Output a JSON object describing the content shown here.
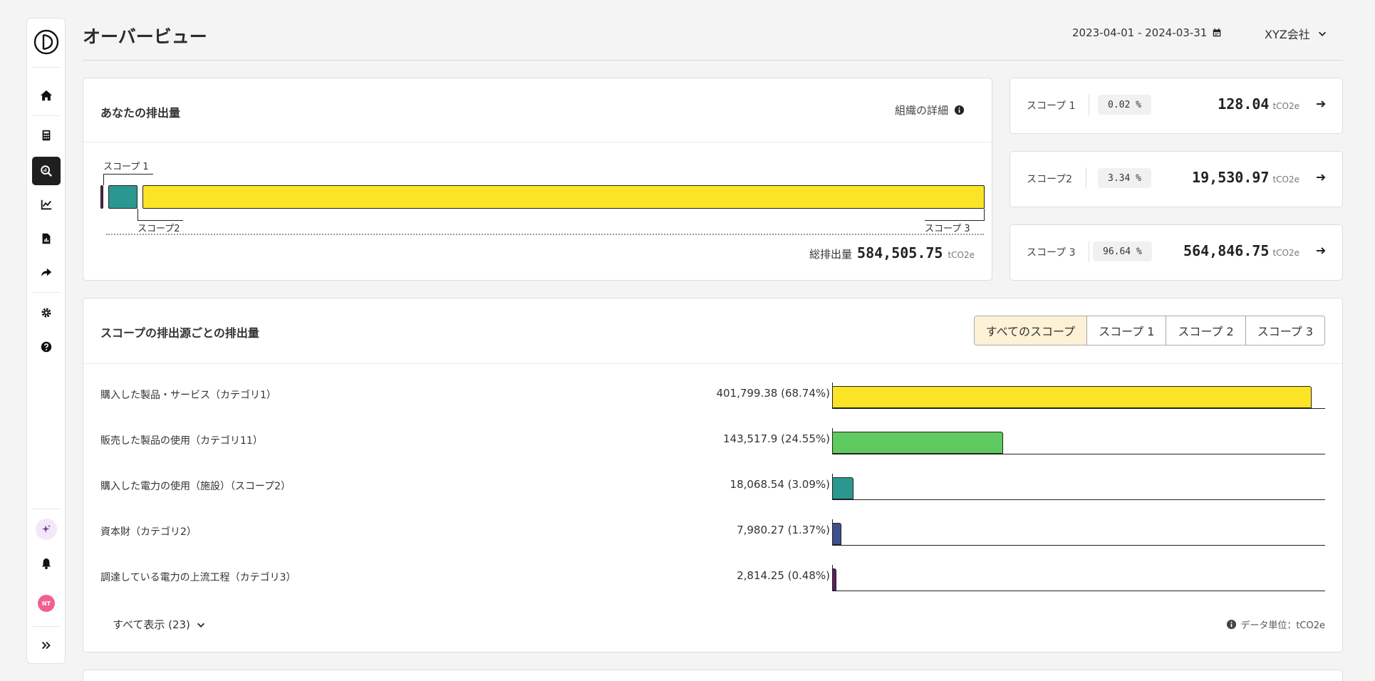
{
  "header": {
    "title": "オーバービュー",
    "date_range": "2023-04-01 - 2024-03-31",
    "company": "XYZ会社"
  },
  "sidebar": {
    "items": [
      "home-icon",
      "calculator-icon",
      "analysis-icon",
      "trend-icon",
      "report-icon",
      "share-icon",
      "settings-icon",
      "help-icon"
    ],
    "active": "analysis-icon",
    "avatar": "NT"
  },
  "emissions": {
    "title": "あなたの排出量",
    "org_detail": "組織の詳細",
    "labels": {
      "scope1": "スコープ 1",
      "scope2": "スコープ2",
      "scope3": "スコープ 3"
    },
    "total_label": "総排出量",
    "total_value": "584,505.75",
    "unit": "tCO2e",
    "shares": {
      "scope1": 0.02,
      "scope2": 3.34,
      "scope3": 96.64
    }
  },
  "scopes": [
    {
      "name": "スコープ 1",
      "pct": "0.02 %",
      "value": "128.04",
      "unit": "tCO2e"
    },
    {
      "name": "スコープ2",
      "pct": "3.34 %",
      "value": "19,530.97",
      "unit": "tCO2e"
    },
    {
      "name": "スコープ 3",
      "pct": "96.64 %",
      "value": "564,846.75",
      "unit": "tCO2e"
    }
  ],
  "colors": {
    "scope1": "#5b1f5e",
    "scope2": "#2a9890",
    "scope3": "#fbe425",
    "category11": "#5fca60",
    "category2": "#3d4f8c",
    "active_tab": "#fdf1d6"
  },
  "sources": {
    "title": "スコープの排出源ごとの排出量",
    "tabs": [
      "すべてのスコープ",
      "スコープ 1",
      "スコープ 2",
      "スコープ 3"
    ],
    "active_tab": 0,
    "rows": [
      {
        "label": "購入した製品・サービス（カテゴリ1）",
        "value": "401,799.38 (68.74%)",
        "share": 68.74,
        "color": "#fbe425"
      },
      {
        "label": "販売した製品の使用（カテゴリ11）",
        "value": "143,517.9 (24.55%)",
        "share": 24.55,
        "color": "#5fca60"
      },
      {
        "label": "購入した電力の使用（施設）（スコープ2）",
        "value": "18,068.54 (3.09%)",
        "share": 3.09,
        "color": "#2a9890"
      },
      {
        "label": "資本財（カテゴリ2）",
        "value": "7,980.27 (1.37%)",
        "share": 1.37,
        "color": "#3d4f8c"
      },
      {
        "label": "調達している電力の上流工程（カテゴリ3）",
        "value": "2,814.25 (0.48%)",
        "share": 0.48,
        "color": "#5b1f5e"
      }
    ],
    "show_all": "すべて表示 (23)",
    "unit_note": "データ単位：tCO2e"
  }
}
